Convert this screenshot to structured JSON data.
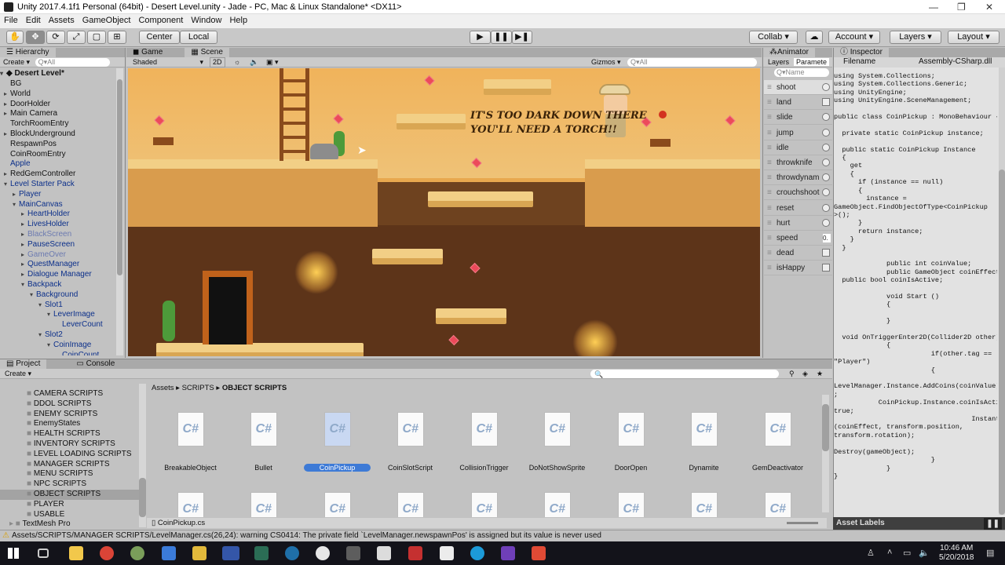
{
  "window": {
    "title": "Unity 2017.4.1f1 Personal (64bit) - Desert Level.unity - Jade - PC, Mac & Linux Standalone* <DX11>"
  },
  "menu": [
    "File",
    "Edit",
    "Assets",
    "GameObject",
    "Component",
    "Window",
    "Help"
  ],
  "toolbar": {
    "center": "Center",
    "local": "Local",
    "collab": "Collab",
    "account": "Account",
    "layers": "Layers",
    "layout": "Layout"
  },
  "hierarchy": {
    "tab": "Hierarchy",
    "create": "Create",
    "search": "Q▾All",
    "scene": "Desert Level*",
    "items": [
      {
        "t": "BG",
        "d": 1,
        "a": ""
      },
      {
        "t": "World",
        "d": 1,
        "a": "▸"
      },
      {
        "t": "DoorHolder",
        "d": 1,
        "a": "▸"
      },
      {
        "t": "Main Camera",
        "d": 1,
        "a": "▸"
      },
      {
        "t": "TorchRoomEntry",
        "d": 1,
        "a": ""
      },
      {
        "t": "BlockUnderground",
        "d": 1,
        "a": "▸"
      },
      {
        "t": "RespawnPos",
        "d": 1,
        "a": ""
      },
      {
        "t": "CoinRoomEntry",
        "d": 1,
        "a": ""
      },
      {
        "t": "Apple",
        "d": 1,
        "a": "",
        "c": "blue"
      },
      {
        "t": "RedGemController",
        "d": 1,
        "a": "▸"
      },
      {
        "t": "Level Starter Pack",
        "d": 1,
        "a": "▾",
        "c": "blue"
      },
      {
        "t": "Player",
        "d": 2,
        "a": "▸",
        "c": "blue"
      },
      {
        "t": "MainCanvas",
        "d": 2,
        "a": "▾",
        "c": "blue"
      },
      {
        "t": "HeartHolder",
        "d": 3,
        "a": "▸",
        "c": "blue"
      },
      {
        "t": "LivesHolder",
        "d": 3,
        "a": "▸",
        "c": "blue"
      },
      {
        "t": "BlackScreen",
        "d": 3,
        "a": "▸",
        "c": "gray"
      },
      {
        "t": "PauseScreen",
        "d": 3,
        "a": "▸",
        "c": "blue"
      },
      {
        "t": "GameOver",
        "d": 3,
        "a": "▸",
        "c": "gray"
      },
      {
        "t": "QuestManager",
        "d": 3,
        "a": "▸",
        "c": "blue"
      },
      {
        "t": "Dialogue Manager",
        "d": 3,
        "a": "▸",
        "c": "blue"
      },
      {
        "t": "Backpack",
        "d": 3,
        "a": "▾",
        "c": "blue"
      },
      {
        "t": "Background",
        "d": 4,
        "a": "▾",
        "c": "blue"
      },
      {
        "t": "Slot1",
        "d": 5,
        "a": "▾",
        "c": "blue"
      },
      {
        "t": "LeverImage",
        "d": 6,
        "a": "▾",
        "c": "blue"
      },
      {
        "t": "LeverCount",
        "d": 7,
        "a": "",
        "c": "blue"
      },
      {
        "t": "Slot2",
        "d": 5,
        "a": "▾",
        "c": "blue"
      },
      {
        "t": "CoinImage",
        "d": 6,
        "a": "▾",
        "c": "blue"
      },
      {
        "t": "CoinCount",
        "d": 7,
        "a": "",
        "c": "blue"
      }
    ]
  },
  "scene": {
    "game_tab": "Game",
    "scene_tab": "Scene",
    "shaded": "Shaded",
    "mode2d": "2D",
    "gizmos": "Gizmos",
    "gizmo_search": "Q▾All",
    "speech": "IT'S TOO DARK DOWN THERE\nYOU'LL NEED A TORCH!!"
  },
  "animator": {
    "tab": "Animator",
    "sub_layers": "Layers",
    "sub_params": "Paramete",
    "search": "Q▾Name",
    "params": [
      {
        "n": "shoot",
        "k": "c"
      },
      {
        "n": "land",
        "k": "s"
      },
      {
        "n": "slide",
        "k": "c"
      },
      {
        "n": "jump",
        "k": "c"
      },
      {
        "n": "idle",
        "k": "c"
      },
      {
        "n": "throwknife",
        "k": "c"
      },
      {
        "n": "throwdynam",
        "k": "c"
      },
      {
        "n": "crouchshoot",
        "k": "c"
      },
      {
        "n": "reset",
        "k": "c"
      },
      {
        "n": "hurt",
        "k": "c"
      },
      {
        "n": "speed",
        "k": "v",
        "v": "0."
      },
      {
        "n": "dead",
        "k": "s"
      },
      {
        "n": "isHappy",
        "k": "s"
      }
    ]
  },
  "inspector": {
    "tab": "Inspector",
    "filename_label": "Filename",
    "filename": "Assembly-CSharp.dll",
    "asset_labels": "Asset Labels",
    "code": "using System.Collections;\nusing System.Collections.Generic;\nusing UnityEngine;\nusing UnityEngine.SceneManagement;\n\npublic class CoinPickup : MonoBehaviour {\n\n  private static CoinPickup instance;\n\n  public static CoinPickup Instance\n  {\n    get\n    {\n      if (instance == null)\n      {\n        instance =\nGameObject.FindObjectOfType<CoinPickup\n>();\n      }\n      return instance;\n    }\n  }\n\n             public int coinValue;\n             public GameObject coinEffect;\n  public bool coinIsActive;\n\n             void Start ()\n             {\n\n             }\n\n  void OnTriggerEnter2D(Collider2D other)\n             {\n                        if(other.tag ==\n\"Player\")\n                        {\n\nLevelManager.Instance.AddCoins(coinValue)\n;\n           CoinPickup.Instance.coinIsActive =\ntrue;\n                                  Instantiate\n(coinEffect, transform.position,\ntransform.rotation);\n\nDestroy(gameObject);\n                        }\n             }\n}"
  },
  "project": {
    "tab": "Project",
    "console_tab": "Console",
    "create": "Create",
    "path": [
      "Assets",
      "SCRIPTS",
      "OBJECT SCRIPTS"
    ],
    "selected_file": "CoinPickup.cs",
    "folders": [
      "CAMERA SCRIPTS",
      "DDOL SCRIPTS",
      "ENEMY SCRIPTS",
      "EnemyStates",
      "HEALTH SCRIPTS",
      "INVENTORY SCRIPTS",
      "LEVEL LOADING SCRIPTS",
      "MANAGER SCRIPTS",
      "MENU SCRIPTS",
      "NPC SCRIPTS",
      "OBJECT SCRIPTS",
      "PLAYER",
      "USABLE",
      "TextMesh Pro"
    ],
    "files": [
      "BreakableObject",
      "Bullet",
      "CoinPickup",
      "CoinSlotScript",
      "CollisionTrigger",
      "DoNotShowSprite",
      "DoorOpen",
      "Dynamite",
      "GemDeactivator"
    ]
  },
  "status": {
    "warning": "Assets/SCRIPTS/MANAGER SCRIPTS/LevelManager.cs(26,24): warning CS0414: The private field `LevelManager.newspawnPos' is assigned but its value is never used"
  },
  "taskbar": {
    "time": "10:46 AM",
    "date": "5/20/2018"
  },
  "colors": {
    "selection": "#3d7ad6",
    "scene_sand": "#e8a84f",
    "dirt": "#6b3f1d"
  }
}
